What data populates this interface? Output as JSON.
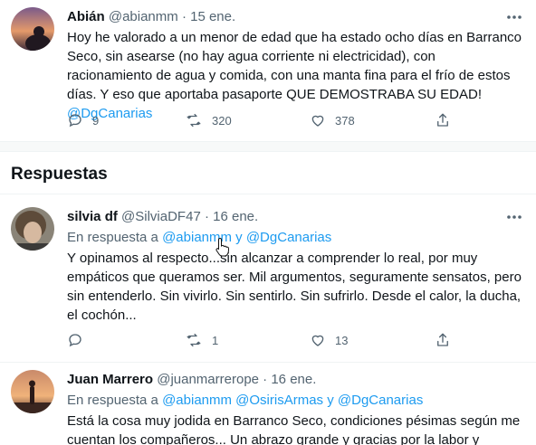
{
  "main_tweet": {
    "name": "Abián",
    "handle": "@abianmm",
    "separator": "·",
    "date": "15 ene.",
    "text": "Hoy he valorado a un menor de edad que ha estado ocho días en Barranco Seco, sin asearse (no hay agua corriente ni electricidad), con racionamiento de agua y comida, con una manta fina para el frío de estos días. Y eso que aportaba pasaporte QUE DEMOSTRABA SU EDAD!",
    "mention": "@DgCanarias",
    "replies": "9",
    "retweets": "320",
    "likes": "378"
  },
  "section": {
    "title": "Respuestas"
  },
  "replies": [
    {
      "name": "silvia df",
      "handle": "@SilviaDF47",
      "separator": "·",
      "date": "16 ene.",
      "replying_prefix": "En respuesta a",
      "replying_to": "@abianmm y @DgCanarias",
      "text": "Y opinamos al respecto...sin alcanzar a comprender lo real, por muy empáticos que queramos ser. Mil argumentos, seguramente sensatos, pero sin entenderlo. Sin vivirlo. Sin sentirlo. Sin sufrirlo. Desde el calor, la ducha, el cochón...",
      "replies": "",
      "retweets": "1",
      "likes": "13"
    },
    {
      "name": "Juan Marrero",
      "handle": "@juanmarrerope",
      "separator": "·",
      "date": "16 ene.",
      "replying_prefix": "En respuesta a",
      "replying_to": "@abianmm @OsirisArmas y @DgCanarias",
      "text": "Está la cosa muy jodida en Barranco Seco, condiciones pésimas según me cuentan los compañeros... Un abrazo grande y gracias por la labor y"
    }
  ],
  "colors": {
    "text": "#0f1419",
    "secondary": "#536471",
    "link": "#1d9bf0",
    "divider": "#eff3f4"
  },
  "icons": [
    "more-icon",
    "reply-icon",
    "retweet-icon",
    "like-icon",
    "share-icon",
    "cursor-icon"
  ]
}
